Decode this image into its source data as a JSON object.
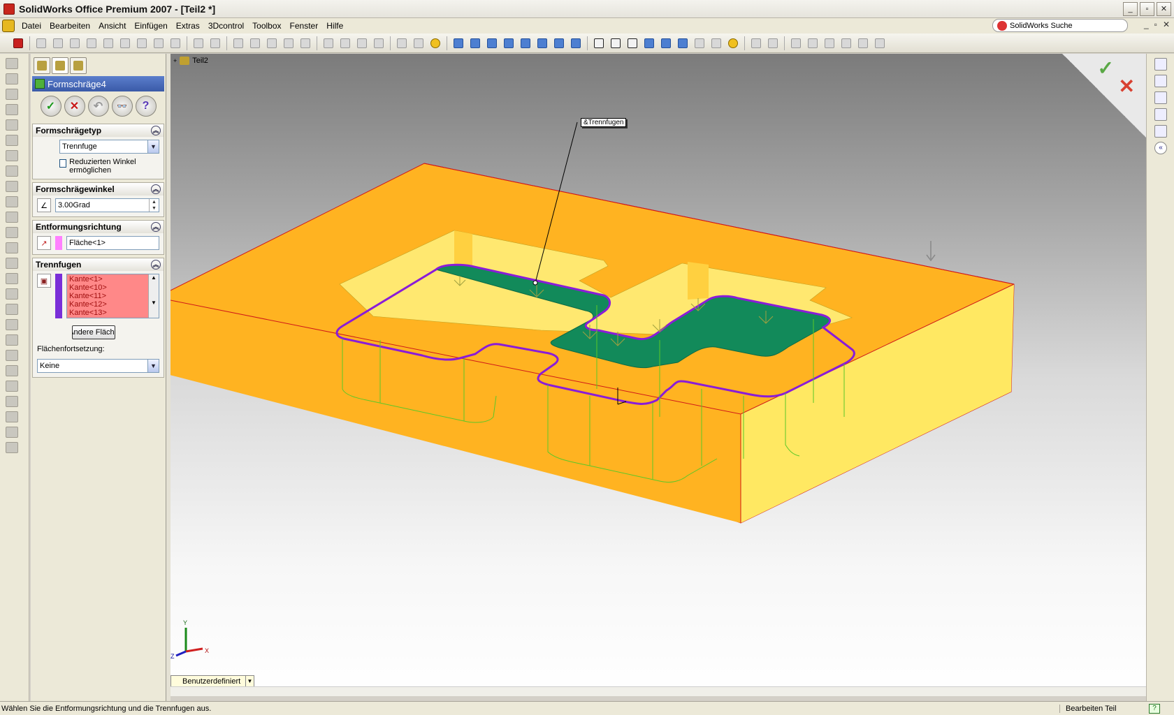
{
  "window": {
    "title": "SolidWorks Office Premium 2007 - [Teil2 *]",
    "minimize": "_",
    "maximize": "▫",
    "close": "✕",
    "mdi_minimize": "_",
    "mdi_restore": "▫",
    "mdi_close": "✕"
  },
  "menu": [
    "Datei",
    "Bearbeiten",
    "Ansicht",
    "Einfügen",
    "Extras",
    "3Dcontrol",
    "Toolbox",
    "Fenster",
    "Hilfe"
  ],
  "search": {
    "placeholder": "SolidWorks Suche"
  },
  "property_manager": {
    "title": "Formschräge4",
    "ok_icon": "✓",
    "cancel_icon": "✕",
    "undo_icon": "↶",
    "detail_icon": "👓",
    "help_icon": "?",
    "groups": {
      "type": {
        "title": "Formschrägetyp",
        "value": "Trennfuge",
        "checkbox_label": "Reduzierten Winkel ermöglichen"
      },
      "angle": {
        "title": "Formschrägewinkel",
        "value": "3.00Grad"
      },
      "direction": {
        "title": "Entformungsrichtung",
        "value": "Fläche<1>",
        "swatch_color": "#ff80ff"
      },
      "parting": {
        "title": "Trennfugen",
        "items": [
          "Kante<1>",
          "Kante<10>",
          "Kante<11>",
          "Kante<12>",
          "Kante<13>"
        ],
        "button": "Andere Fläche",
        "continuation_label": "Flächenfortsetzung:",
        "continuation_value": "Keine",
        "swatch_color": "#7a2fd8"
      }
    }
  },
  "viewport": {
    "tree_root": "Teil2",
    "callout": "&Trennfugen",
    "view_orientation": "Benutzerdefiniert",
    "axes": {
      "x": "X",
      "y": "Y",
      "z": "Z"
    },
    "colors": {
      "body": "#ffb020",
      "body_light": "#ffe870",
      "parting_face": "#128a5a",
      "parting_line": "#8a1cd8",
      "edge": "#d01818",
      "preview": "#5ac828"
    }
  },
  "status": {
    "message": "Wählen Sie die Entformungsrichtung und die Trennfugen aus.",
    "mode": "Bearbeiten Teil",
    "help": "?"
  }
}
